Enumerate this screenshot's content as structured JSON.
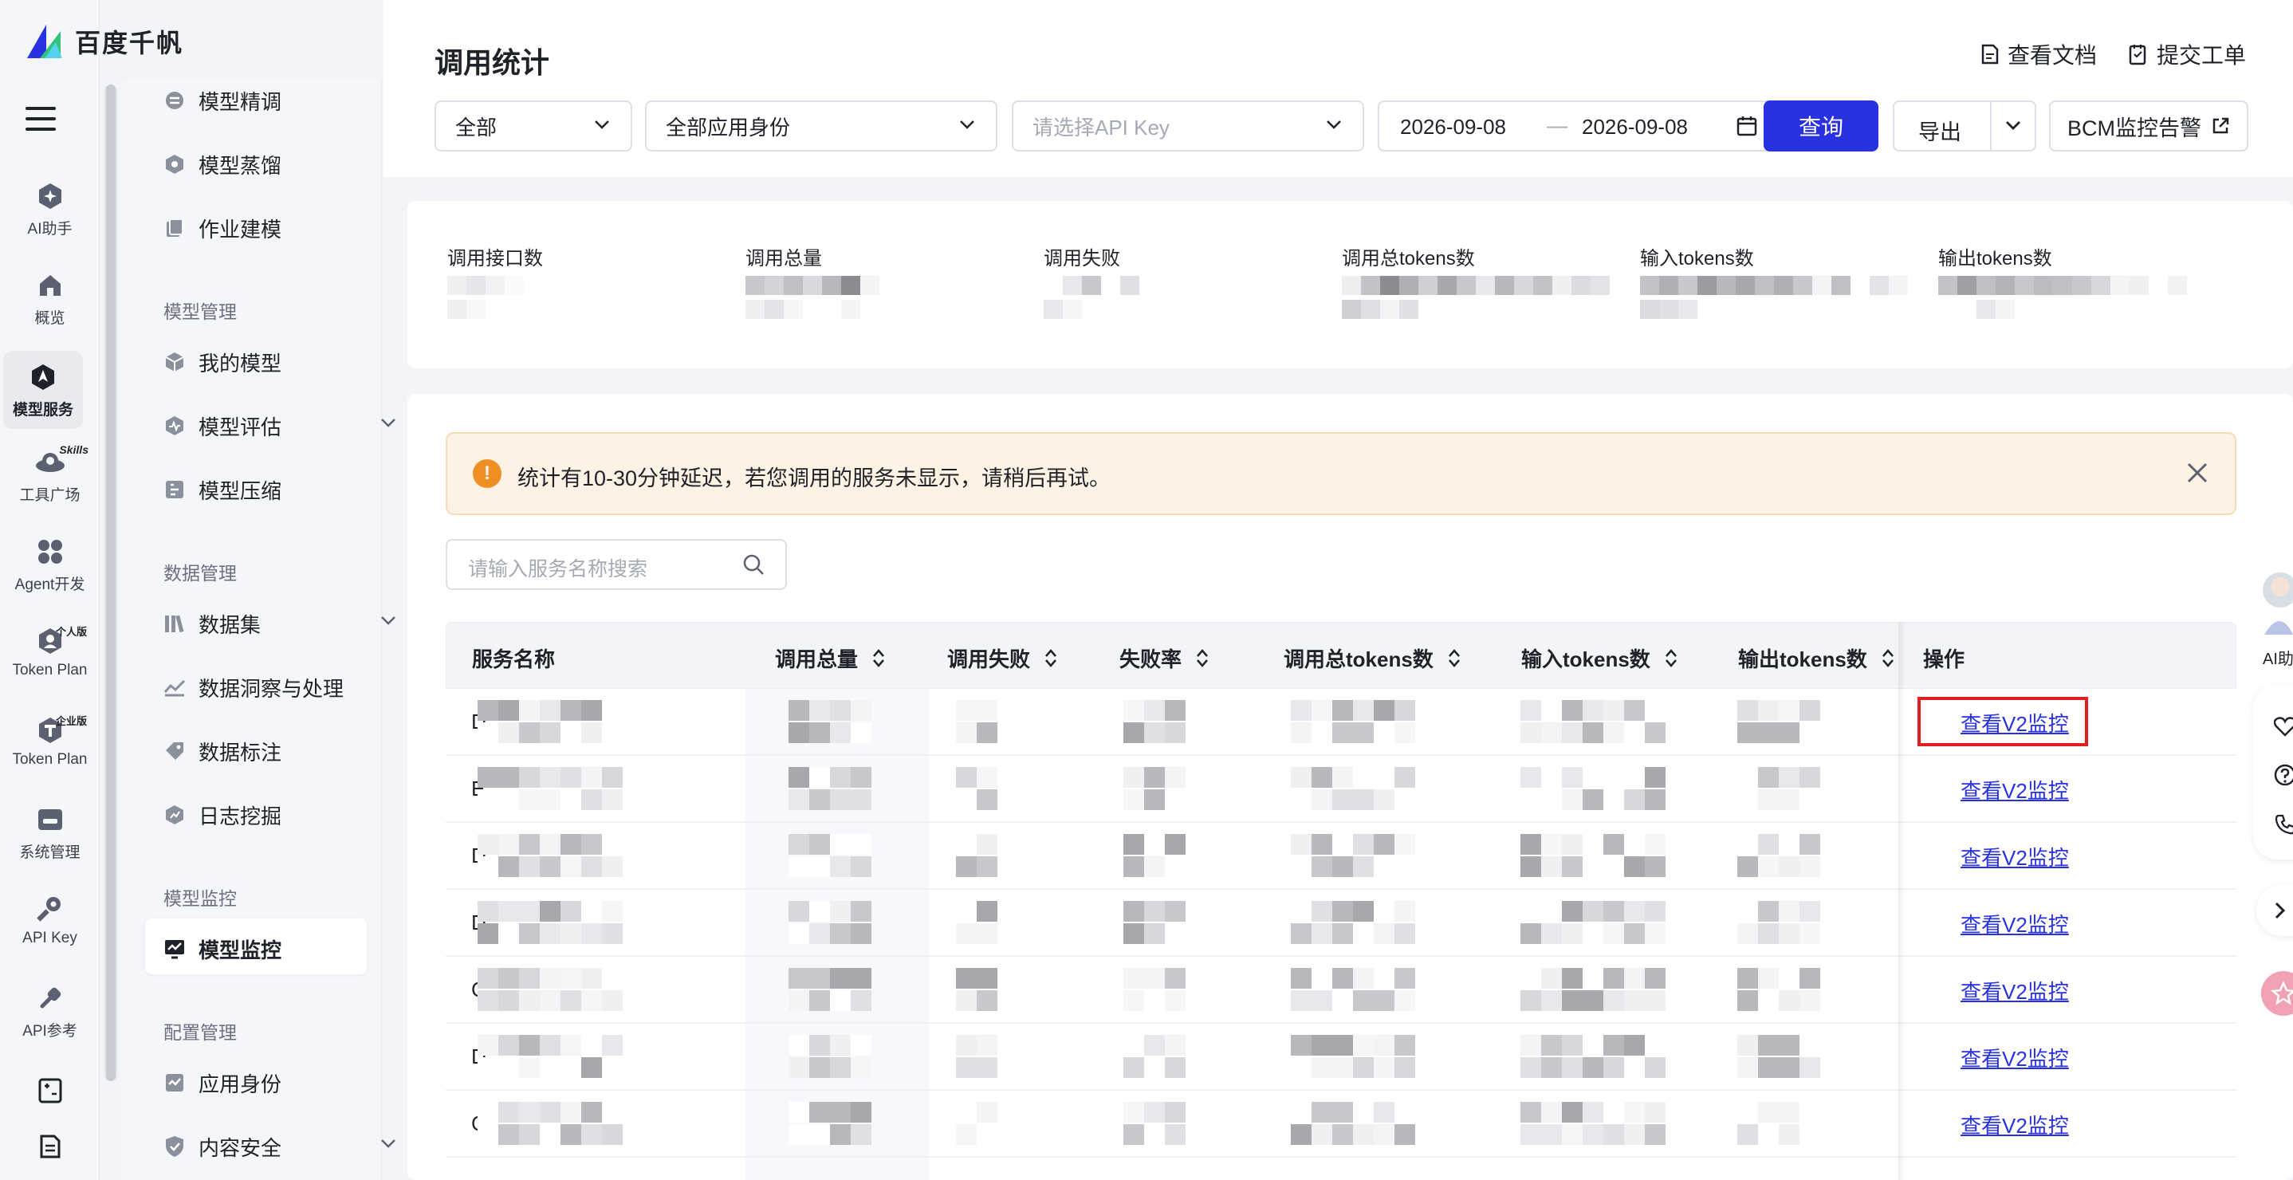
{
  "brand": {
    "name": "百度千帆"
  },
  "rail": {
    "items": [
      {
        "label": "AI助手",
        "icon": "ai-assistant-icon"
      },
      {
        "label": "概览",
        "icon": "home-icon"
      },
      {
        "label": "模型服务",
        "icon": "model-service-icon",
        "active": true
      },
      {
        "label": "工具广场",
        "icon": "tool-plaza-icon",
        "badge": "Skills"
      },
      {
        "label": "Agent开发",
        "icon": "agent-icon"
      },
      {
        "label": "Token Plan",
        "icon": "token-plan-personal-icon",
        "badge": "个人版"
      },
      {
        "label": "Token Plan",
        "icon": "token-plan-enterprise-icon",
        "badge": "企业版"
      },
      {
        "label": "系统管理",
        "icon": "system-icon"
      },
      {
        "label": "API Key",
        "icon": "key-icon"
      },
      {
        "label": "API参考",
        "icon": "api-ref-icon"
      }
    ]
  },
  "subnav": {
    "items_top": [
      "模型精调",
      "模型蒸馏",
      "作业建模"
    ],
    "groups": [
      {
        "title": "模型管理",
        "items": [
          "我的模型",
          "模型评估",
          "模型压缩"
        ]
      },
      {
        "title": "数据管理",
        "items": [
          "数据集",
          "数据洞察与处理",
          "数据标注",
          "日志挖掘"
        ]
      },
      {
        "title": "模型监控",
        "items": [
          "模型监控"
        ]
      },
      {
        "title": "配置管理",
        "items": [
          "应用身份",
          "内容安全"
        ]
      }
    ]
  },
  "page": {
    "title": "调用统计",
    "links": {
      "docs": "查看文档",
      "ticket": "提交工单"
    }
  },
  "filters": {
    "scope": "全部",
    "app_identity": "全部应用身份",
    "api_key_placeholder": "请选择API Key",
    "date_start": "2026-09-08",
    "date_sep": "—",
    "date_end": "2026-09-08",
    "query_label": "查询",
    "export_label": "导出",
    "bcm_label": "BCM监控告警"
  },
  "stats": {
    "labels": [
      "调用接口数",
      "调用总量",
      "调用失败",
      "调用总tokens数",
      "输入tokens数",
      "输出tokens数"
    ]
  },
  "alert": {
    "text": "统计有10-30分钟延迟，若您调用的服务未显示，请稍后再试。"
  },
  "search": {
    "placeholder": "请输入服务名称搜索"
  },
  "table": {
    "columns": [
      "服务名称",
      "调用总量",
      "调用失败",
      "失败率",
      "调用总tokens数",
      "输入tokens数",
      "输出tokens数",
      "操作"
    ],
    "rows": [
      {
        "name_prefix": "D",
        "action": "查看V2监控"
      },
      {
        "name_prefix": "E",
        "action": "查看V2监控"
      },
      {
        "name_prefix": "D",
        "action": "查看V2监控"
      },
      {
        "name_prefix": "D",
        "action": "查看V2监控"
      },
      {
        "name_prefix": "C",
        "action": "查看V2监控"
      },
      {
        "name_prefix": "D",
        "action": "查看V2监控"
      },
      {
        "name_prefix": "C",
        "action": "查看V2监控"
      }
    ]
  },
  "floating": {
    "ai_label": "AI助"
  },
  "colors": {
    "primary": "#2932e1",
    "alert_bg": "#fdf2e4",
    "warning": "#ef8f23",
    "highlight": "#e02020"
  }
}
